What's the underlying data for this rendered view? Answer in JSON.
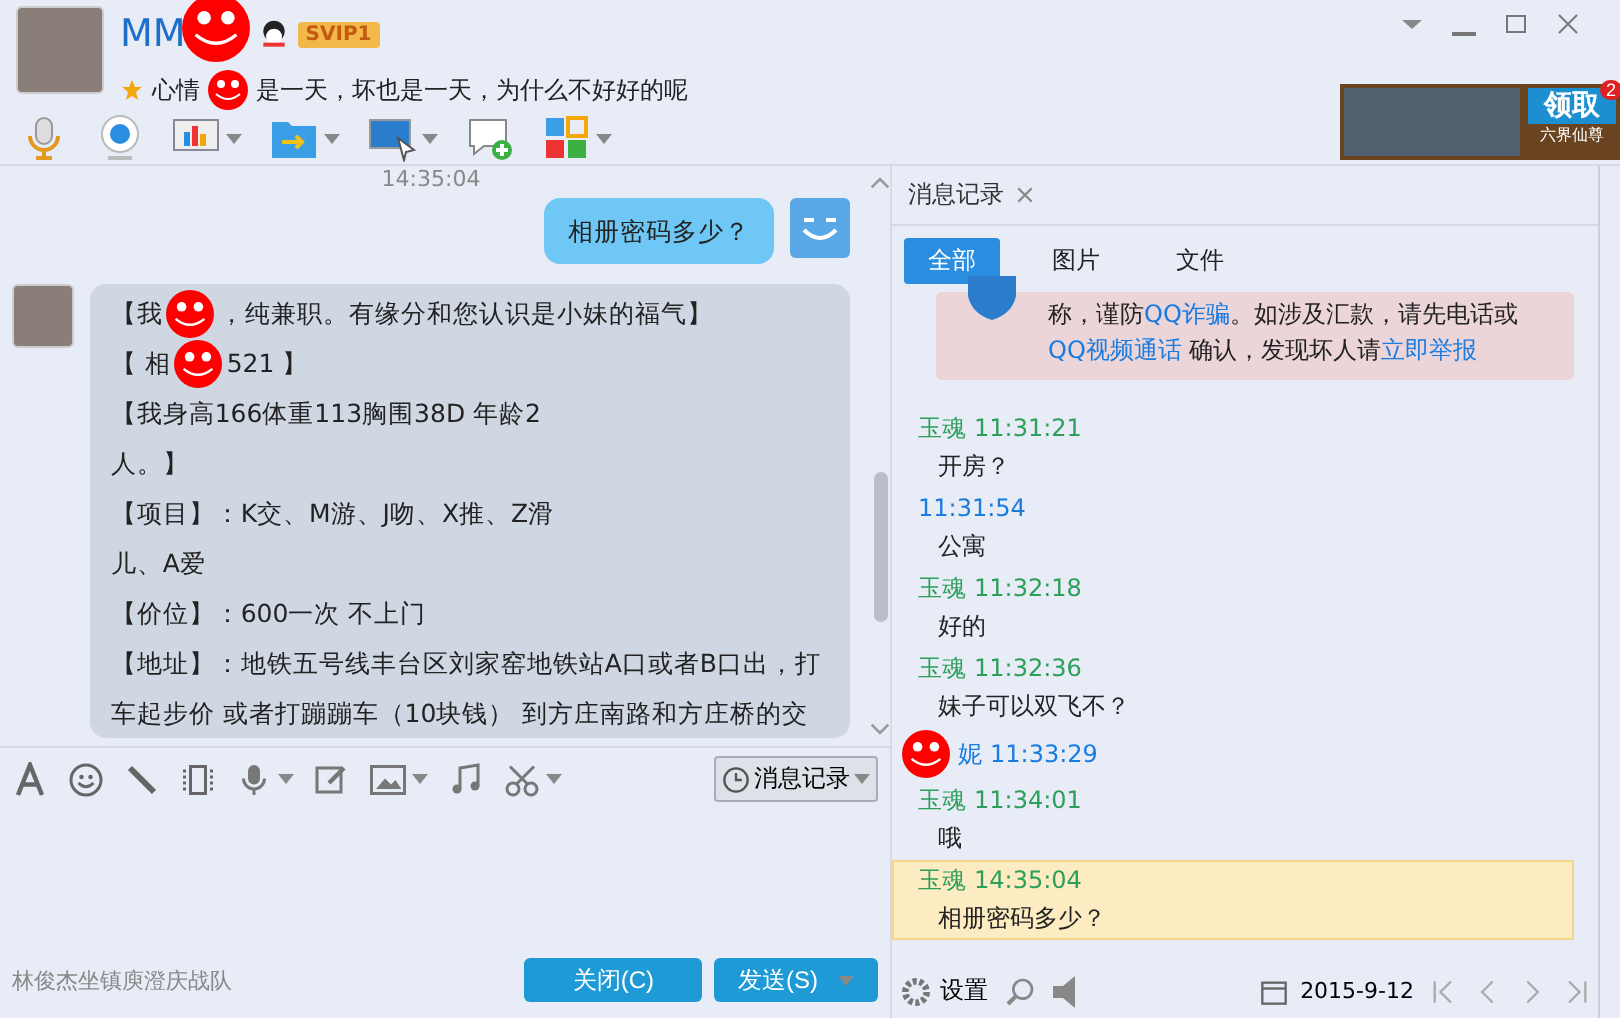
{
  "contact": {
    "name": "MM",
    "vip_badge": "SVIP1",
    "signature": [
      {
        "kind": "text",
        "text": "心情"
      },
      {
        "kind": "redacted"
      },
      {
        "kind": "text",
        "text": "是一天，坏也是一天，为什么不好好的呢"
      }
    ]
  },
  "ad": {
    "button": "领取",
    "badge": "2",
    "caption": "六界仙尊"
  },
  "chat": {
    "timestamp": "14:35:04",
    "messages": [
      {
        "kind": "outgoing",
        "lines": [
          [
            {
              "kind": "text",
              "text": "相册密码多少？"
            }
          ]
        ]
      },
      {
        "kind": "incoming",
        "lines": [
          [
            {
              "kind": "text",
              "text": "【我"
            },
            {
              "kind": "redacted"
            },
            {
              "kind": "text",
              "text": "，纯兼职。有缘分和您认识是小妹的福气】"
            }
          ],
          [
            {
              "kind": "text",
              "text": "【 相"
            },
            {
              "kind": "redacted"
            },
            {
              "kind": "text",
              "text": "521 】"
            }
          ],
          [
            {
              "kind": "text",
              "text": "【我身高166体重113胸围38D 年龄2"
            }
          ],
          [
            {
              "kind": "text",
              "text": "人。】"
            }
          ],
          [
            {
              "kind": "text",
              "text": "【项目】：K交、M游、J吻、X推、Z滑"
            }
          ],
          [
            {
              "kind": "text",
              "text": "儿、A爱"
            }
          ],
          [
            {
              "kind": "text",
              "text": "【价位】：600一次  不上门"
            }
          ],
          [
            {
              "kind": "text",
              "text": "【地址】：地铁五号线丰台区刘家窑地铁站A口或者B口出，打"
            }
          ],
          [
            {
              "kind": "text",
              "text": "车起步价 或者打蹦蹦车（10块钱） 到方庄南路和方庄桥的交"
            }
          ]
        ]
      }
    ]
  },
  "input": {
    "history_button": "消息记录"
  },
  "footer": {
    "ticker": "林俊杰坐镇庾澄庆战队",
    "close_button": "关闭(C)",
    "send_button": "发送(S)"
  },
  "history": {
    "tab": "消息记录",
    "filters": [
      {
        "label": "全部",
        "selected": true
      },
      {
        "label": "图片",
        "selected": false
      },
      {
        "label": "文件",
        "selected": false
      }
    ],
    "notice": [
      [
        {
          "kind": "text",
          "text": "称，谨防"
        },
        {
          "kind": "link",
          "text": "QQ诈骗"
        },
        {
          "kind": "text",
          "text": "。如涉及汇款，请先电话或"
        }
      ],
      [
        {
          "kind": "link",
          "text": "QQ视频通话"
        },
        {
          "kind": "text",
          "text": " 确认，发现坏人请"
        },
        {
          "kind": "link",
          "text": "立即举报"
        }
      ]
    ],
    "entries": [
      {
        "sender": "玉魂",
        "kind": "self",
        "time": "11:31:21",
        "text": "开房？",
        "redacted": false,
        "selected": false
      },
      {
        "kind": "other",
        "time": "11:31:54",
        "text": "公寓",
        "redacted": false,
        "selected": false
      },
      {
        "sender": "玉魂",
        "kind": "self",
        "time": "11:32:18",
        "text": "好的",
        "redacted": false,
        "selected": false
      },
      {
        "sender": "玉魂",
        "kind": "self",
        "time": "11:32:36",
        "text": "妹子可以双飞不？",
        "redacted": false,
        "selected": false
      },
      {
        "sender": "妮",
        "kind": "other",
        "time": "11:33:29",
        "redacted": true,
        "selected": false
      },
      {
        "sender": "玉魂",
        "kind": "self",
        "time": "11:34:01",
        "text": "哦",
        "redacted": false,
        "selected": false
      },
      {
        "sender": "玉魂",
        "kind": "self",
        "time": "14:35:04",
        "text": "相册密码多少？",
        "redacted": false,
        "selected": true
      }
    ],
    "settings": "设置",
    "date": "2015-9-12"
  }
}
